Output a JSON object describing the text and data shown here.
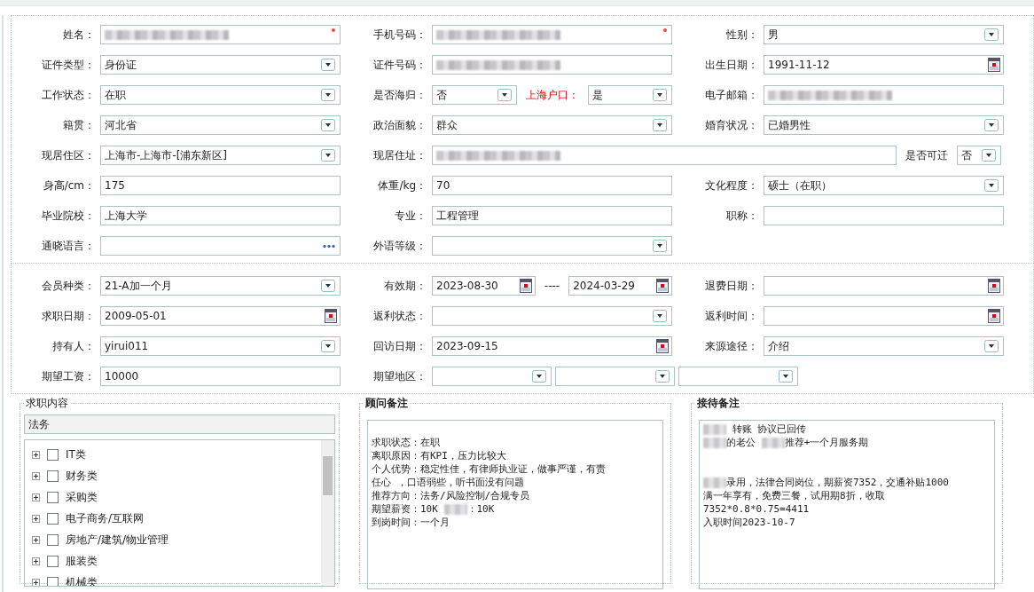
{
  "profile": {
    "rows": [
      {
        "cells": [
          {
            "label": "姓名：",
            "controls": [
              {
                "kind": "text",
                "redacted": true,
                "required": true
              }
            ]
          },
          {
            "label": "手机号码：",
            "controls": [
              {
                "kind": "text",
                "redacted": true,
                "required": true
              }
            ]
          },
          {
            "label": "性别：",
            "controls": [
              {
                "kind": "select",
                "value": "男"
              }
            ]
          }
        ]
      },
      {
        "cells": [
          {
            "label": "证件类型：",
            "controls": [
              {
                "kind": "select",
                "value": "身份证"
              }
            ]
          },
          {
            "label": "证件号码：",
            "controls": [
              {
                "kind": "text",
                "redacted": true
              }
            ]
          },
          {
            "label": "出生日期：",
            "controls": [
              {
                "kind": "date",
                "value": "1991-11-12"
              }
            ]
          }
        ]
      },
      {
        "cells": [
          {
            "label": "工作状态：",
            "controls": [
              {
                "kind": "select",
                "value": "在职"
              }
            ]
          },
          {
            "label": "是否海归：",
            "controls": [
              {
                "kind": "select",
                "value": "否"
              },
              {
                "kind": "label",
                "text": "上海户口：",
                "emphasis": true
              },
              {
                "kind": "select",
                "value": "是"
              }
            ]
          },
          {
            "label": "电子邮箱：",
            "controls": [
              {
                "kind": "text",
                "redacted": true
              }
            ]
          }
        ]
      },
      {
        "cells": [
          {
            "label": "籍贯：",
            "controls": [
              {
                "kind": "select",
                "value": "河北省"
              }
            ]
          },
          {
            "label": "政治面貌：",
            "controls": [
              {
                "kind": "select",
                "value": "群众"
              }
            ]
          },
          {
            "label": "婚育状况：",
            "controls": [
              {
                "kind": "select",
                "value": "已婚男性"
              }
            ]
          }
        ]
      },
      {
        "cells": [
          {
            "label": "现居住区：",
            "controls": [
              {
                "kind": "select",
                "value": " 上海市-上海市-[浦东新区]"
              }
            ]
          },
          {
            "label": "现居住址：",
            "wide": true,
            "controls": [
              {
                "kind": "text",
                "redacted": true
              },
              {
                "kind": "label",
                "text": "是否可迁",
                "emphasis": false
              },
              {
                "kind": "select",
                "value": "否"
              }
            ]
          }
        ]
      },
      {
        "cells": [
          {
            "label": "身高/cm：",
            "controls": [
              {
                "kind": "text",
                "value": "175"
              }
            ]
          },
          {
            "label": "体重/kg：",
            "controls": [
              {
                "kind": "text",
                "value": "70"
              }
            ]
          },
          {
            "label": "文化程度：",
            "controls": [
              {
                "kind": "select",
                "value": "硕士（在职）"
              }
            ]
          }
        ]
      },
      {
        "cells": [
          {
            "label": "毕业院校：",
            "controls": [
              {
                "kind": "text",
                "value": "上海大学"
              }
            ]
          },
          {
            "label": "专业：",
            "controls": [
              {
                "kind": "text",
                "value": "工程管理"
              }
            ]
          },
          {
            "label": "职称：",
            "controls": [
              {
                "kind": "text"
              }
            ]
          }
        ]
      },
      {
        "cells": [
          {
            "label": "通晓语言：",
            "controls": [
              {
                "kind": "lookup"
              }
            ]
          },
          {
            "label": "外语等级：",
            "controls": [
              {
                "kind": "select"
              }
            ]
          }
        ]
      }
    ]
  },
  "membership": {
    "rows": [
      {
        "cells": [
          {
            "label": "会员种类：",
            "controls": [
              {
                "kind": "select",
                "value": " 21-A加一个月"
              }
            ]
          },
          {
            "label": "有效期：",
            "controls": [
              {
                "kind": "date",
                "value": "2023-08-30"
              },
              {
                "kind": "label",
                "text": "----",
                "emphasis": false
              },
              {
                "kind": "date",
                "value": "2024-03-29"
              }
            ]
          },
          {
            "label": "退费日期：",
            "controls": [
              {
                "kind": "date"
              }
            ]
          }
        ]
      },
      {
        "cells": [
          {
            "label": "求职日期：",
            "controls": [
              {
                "kind": "date",
                "value": "2009-05-01"
              }
            ]
          },
          {
            "label": "返利状态：",
            "controls": [
              {
                "kind": "select"
              }
            ]
          },
          {
            "label": "返利时间：",
            "controls": [
              {
                "kind": "date"
              }
            ]
          }
        ]
      },
      {
        "cells": [
          {
            "label": "持有人：",
            "controls": [
              {
                "kind": "select",
                "value": "yirui011"
              }
            ]
          },
          {
            "label": "回访日期：",
            "controls": [
              {
                "kind": "date",
                "value": "2023-09-15"
              }
            ]
          },
          {
            "label": "来源途径：",
            "controls": [
              {
                "kind": "select",
                "value": "介绍"
              }
            ]
          }
        ]
      },
      {
        "cells": [
          {
            "label": "期望工资：",
            "controls": [
              {
                "kind": "text",
                "value": "10000"
              }
            ]
          },
          {
            "label": "期望地区：",
            "wide": true,
            "controls": [
              {
                "kind": "select"
              },
              {
                "kind": "select"
              },
              {
                "kind": "select"
              }
            ]
          }
        ]
      }
    ]
  },
  "job_content": {
    "title": "求职内容",
    "search": {
      "value": "法务"
    },
    "tree": [
      {
        "label": "IT类",
        "checked": false,
        "expanded": false
      },
      {
        "label": "财务类",
        "checked": false,
        "expanded": false
      },
      {
        "label": "采购类",
        "checked": false,
        "expanded": false
      },
      {
        "label": "电子商务/互联网",
        "checked": false,
        "expanded": false
      },
      {
        "label": "房地产/建筑/物业管理",
        "checked": false,
        "expanded": false
      },
      {
        "label": "服装类",
        "checked": false,
        "expanded": false
      },
      {
        "label": "机械类",
        "checked": false,
        "expanded": false
      }
    ]
  },
  "notes": [
    {
      "title": "顾问备注",
      "lines": [
        {
          "kind": "blank"
        },
        {
          "parts": [
            "求职状态：在职"
          ]
        },
        {
          "parts": [
            "离职原因：有KPI，压力比较大"
          ]
        },
        {
          "parts": [
            "个人优势：稳定性佳，有律师执业证，做事严谨，有责"
          ]
        },
        {
          "parts": [
            "任心 ，口语弱些，听书面没有问题"
          ]
        },
        {
          "parts": [
            "推荐方向：法务/风险控制/合规专员"
          ]
        },
        {
          "parts": [
            "期望薪资：10K ",
            {
              "redacted": true
            },
            "：10K"
          ]
        },
        {
          "parts": [
            "到岗时间：一个月"
          ]
        }
      ]
    },
    {
      "title": "接待备注",
      "lines": [
        {
          "parts": [
            {
              "redacted": true
            },
            " 转账 协议已回传"
          ]
        },
        {
          "parts": [
            {
              "redacted": true
            },
            "的老公 ",
            {
              "redacted": true
            },
            "推荐+一个月服务期"
          ]
        },
        {
          "kind": "blank"
        },
        {
          "kind": "blank"
        },
        {
          "parts": [
            {
              "redacted": true
            },
            "录用，法律合同岗位，期薪资7352，交通补贴1000"
          ]
        },
        {
          "parts": [
            "满一年享有，免费三餐，试用期8折，收取"
          ]
        },
        {
          "parts": [
            "7352*0.8*0.75=4411"
          ]
        },
        {
          "parts": [
            "入职时间2023-10-7"
          ]
        }
      ]
    }
  ]
}
